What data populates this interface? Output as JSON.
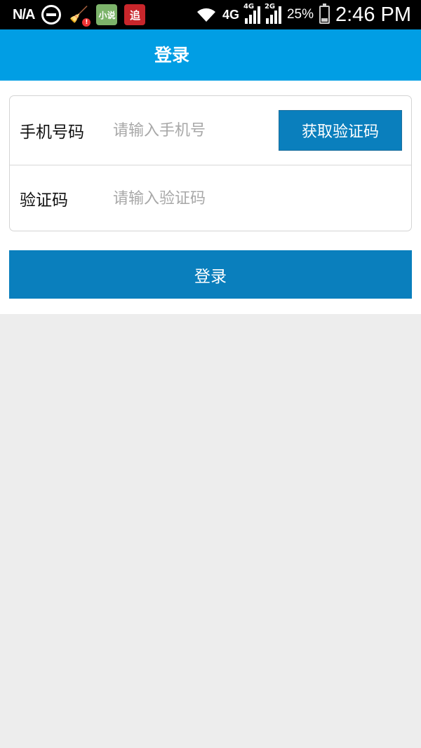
{
  "status_bar": {
    "carrier": "N/A",
    "icons": [
      "do-not-disturb-icon",
      "cleaner-app-icon",
      "novel-app-icon",
      "zhui-app-icon",
      "wifi-icon",
      "signal-icon",
      "signal-icon",
      "battery-icon"
    ],
    "novel_app_text": "小说",
    "zhui_app_text": "追",
    "network_4g": "4G",
    "sig1_tag": "4G",
    "sig2_tag": "2G",
    "battery_percent": "25%",
    "time": "2:46 PM"
  },
  "header": {
    "title": "登录",
    "background": "#019ee4"
  },
  "form": {
    "phone": {
      "label": "手机号码",
      "placeholder": "请输入手机号",
      "value": ""
    },
    "get_code_button": "获取验证码",
    "code": {
      "label": "验证码",
      "placeholder": "请输入验证码",
      "value": ""
    }
  },
  "login_button": "登录",
  "colors": {
    "accent": "#0a7fbd",
    "header": "#019ee4",
    "background": "#ededed"
  }
}
